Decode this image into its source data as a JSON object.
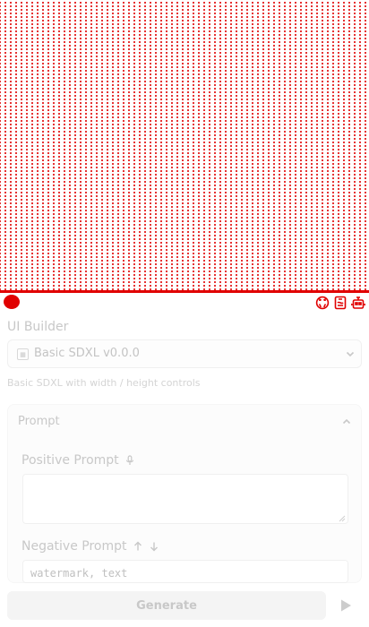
{
  "builder": {
    "title": "UI Builder",
    "selected_template": "Basic SDXL v0.0.0",
    "description": "Basic SDXL with width / height controls"
  },
  "prompt_panel": {
    "title": "Prompt",
    "positive_label": "Positive Prompt",
    "positive_value": "",
    "negative_label": "Negative Prompt",
    "negative_value": "watermark, text"
  },
  "actions": {
    "generate_label": "Generate"
  },
  "colors": {
    "accent": "#e00000",
    "muted_text": "#c8c8c8"
  },
  "icons": {
    "status": "status-dot-icon",
    "github": "github-icon",
    "docs": "docs-icon",
    "bot": "robot-icon",
    "mic": "microphone-icon",
    "upload": "arrow-up-icon",
    "download": "arrow-down-icon",
    "play": "play-icon"
  }
}
